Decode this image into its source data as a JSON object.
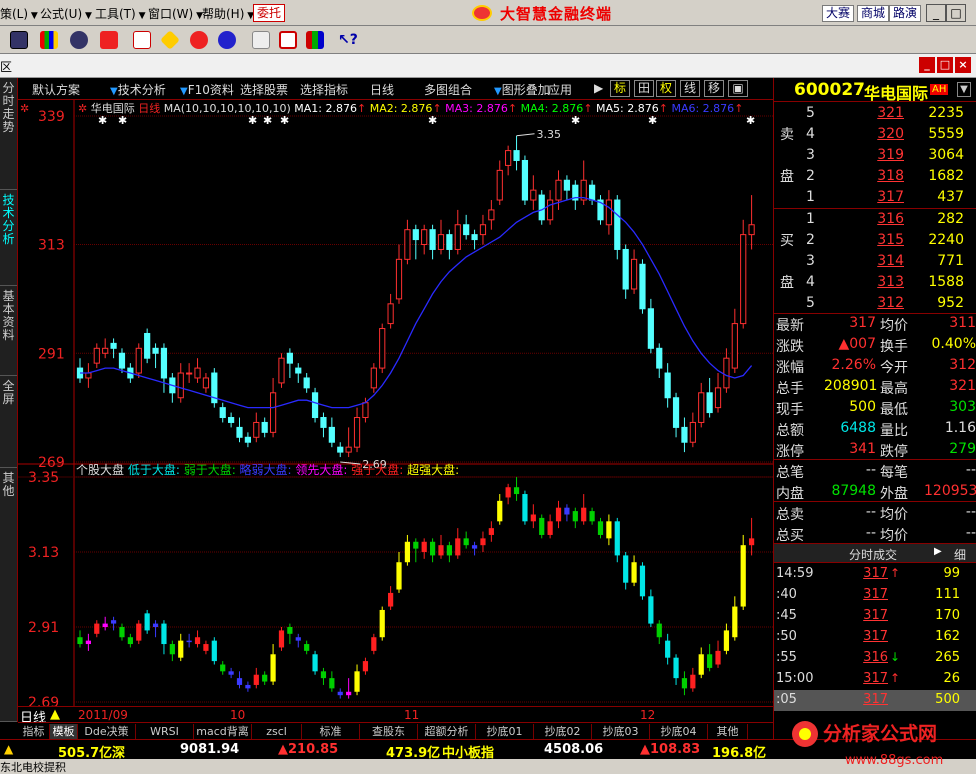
{
  "menu": {
    "items": [
      {
        "label": "策(L)",
        "x": 0
      },
      {
        "label": "公式(U)",
        "x": 40
      },
      {
        "label": "工具(T)",
        "x": 95
      },
      {
        "label": "窗口(W)",
        "x": 148
      },
      {
        "label": "帮助(H)",
        "x": 202
      }
    ],
    "entrust": "委托",
    "app_title": "大智慧金融终端",
    "buttons": [
      "大赛",
      "商城",
      "路演"
    ],
    "window_buttons": [
      "_",
      "□",
      "×"
    ]
  },
  "subbar": {
    "label": "区",
    "buttons": [
      "_",
      "□",
      "×"
    ]
  },
  "left_tabs": [
    "分时走势",
    "技术分析",
    "基本资料",
    "全屏",
    "其他"
  ],
  "chart_tools": {
    "items": [
      "默认方案",
      "技术分析",
      "F10资料",
      "选择股票",
      "选择指标",
      "日线",
      "多图组合",
      "图形叠加",
      "应用"
    ],
    "boxes": [
      "标",
      "田",
      "权",
      "线",
      "移",
      "▣",
      "□",
      "◫"
    ]
  },
  "price_chart": {
    "name": "华电国际",
    "period": "日线",
    "ma_params": "MA(10,10,10,10,10,10)",
    "ma": [
      {
        "label": "MA1:",
        "value": "2.876",
        "color": "#ffffff"
      },
      {
        "label": "MA2:",
        "value": "2.876",
        "color": "#ffff00"
      },
      {
        "label": "MA3:",
        "value": "2.876",
        "color": "#ff00ff"
      },
      {
        "label": "MA4:",
        "value": "2.876",
        "color": "#00ff00"
      },
      {
        "label": "MA5:",
        "value": "2.876",
        "color": "#ffffff"
      },
      {
        "label": "MA6:",
        "value": "2.876",
        "color": "#3a3aff"
      }
    ],
    "axis_labels": [
      "339",
      "313",
      "291",
      "269"
    ],
    "high_note": "3.35",
    "low_note": "2.69"
  },
  "indicator_chart": {
    "name": "个股大盘",
    "legend": [
      {
        "label": "低于大盘:",
        "color": "#00e6e6"
      },
      {
        "label": "弱于大盘:",
        "color": "#00d000"
      },
      {
        "label": "略弱大盘:",
        "color": "#3a3aff"
      },
      {
        "label": "领先大盘:",
        "color": "#ff00ff"
      },
      {
        "label": "强于大盘:",
        "color": "#ff2020"
      },
      {
        "label": "超强大盘:",
        "color": "#ffff00"
      }
    ],
    "axis_labels": [
      "3.35",
      "3.13",
      "2.91",
      "2.69"
    ]
  },
  "chart_data": {
    "type": "candlestick",
    "categories": [
      "2011/09",
      "10",
      "11",
      "12"
    ],
    "ylim": [
      2.69,
      3.39
    ],
    "candles": [
      [
        2.88,
        2.86,
        2.9,
        2.85
      ],
      [
        2.86,
        2.87,
        2.89,
        2.84
      ],
      [
        2.89,
        2.92,
        2.93,
        2.88
      ],
      [
        2.91,
        2.92,
        2.94,
        2.9
      ],
      [
        2.93,
        2.92,
        2.94,
        2.9
      ],
      [
        2.91,
        2.88,
        2.92,
        2.87
      ],
      [
        2.88,
        2.86,
        2.89,
        2.85
      ],
      [
        2.87,
        2.92,
        2.93,
        2.86
      ],
      [
        2.95,
        2.9,
        2.96,
        2.89
      ],
      [
        2.92,
        2.91,
        2.93,
        2.88
      ],
      [
        2.92,
        2.86,
        2.93,
        2.83
      ],
      [
        2.86,
        2.83,
        2.87,
        2.81
      ],
      [
        2.82,
        2.87,
        2.89,
        2.81
      ],
      [
        2.87,
        2.87,
        2.89,
        2.85
      ],
      [
        2.86,
        2.88,
        2.9,
        2.85
      ],
      [
        2.84,
        2.86,
        2.87,
        2.83
      ],
      [
        2.87,
        2.81,
        2.88,
        2.8
      ],
      [
        2.8,
        2.78,
        2.81,
        2.77
      ],
      [
        2.78,
        2.77,
        2.79,
        2.76
      ],
      [
        2.76,
        2.74,
        2.78,
        2.73
      ],
      [
        2.74,
        2.73,
        2.75,
        2.72
      ],
      [
        2.74,
        2.77,
        2.79,
        2.73
      ],
      [
        2.77,
        2.75,
        2.78,
        2.74
      ],
      [
        2.75,
        2.83,
        2.86,
        2.74
      ],
      [
        2.85,
        2.9,
        2.91,
        2.84
      ],
      [
        2.91,
        2.89,
        2.92,
        2.86
      ],
      [
        2.88,
        2.87,
        2.89,
        2.85
      ],
      [
        2.86,
        2.84,
        2.87,
        2.83
      ],
      [
        2.83,
        2.78,
        2.84,
        2.77
      ],
      [
        2.78,
        2.76,
        2.79,
        2.74
      ],
      [
        2.76,
        2.73,
        2.78,
        2.72
      ],
      [
        2.72,
        2.71,
        2.73,
        2.7
      ],
      [
        2.71,
        2.72,
        2.76,
        2.7
      ],
      [
        2.72,
        2.78,
        2.8,
        2.71
      ],
      [
        2.78,
        2.81,
        2.82,
        2.77
      ],
      [
        2.84,
        2.88,
        2.89,
        2.83
      ],
      [
        2.88,
        2.96,
        2.97,
        2.87
      ],
      [
        2.97,
        3.01,
        3.03,
        2.96
      ],
      [
        3.02,
        3.1,
        3.13,
        3.01
      ],
      [
        3.1,
        3.16,
        3.18,
        3.09
      ],
      [
        3.16,
        3.14,
        3.17,
        3.1
      ],
      [
        3.13,
        3.16,
        3.17,
        3.11
      ],
      [
        3.16,
        3.12,
        3.17,
        3.1
      ],
      [
        3.12,
        3.15,
        3.18,
        3.11
      ],
      [
        3.15,
        3.12,
        3.16,
        3.1
      ],
      [
        3.12,
        3.17,
        3.2,
        3.11
      ],
      [
        3.17,
        3.15,
        3.19,
        3.14
      ],
      [
        3.15,
        3.14,
        3.16,
        3.12
      ],
      [
        3.15,
        3.17,
        3.19,
        3.13
      ],
      [
        3.18,
        3.2,
        3.22,
        3.16
      ],
      [
        3.22,
        3.28,
        3.3,
        3.21
      ],
      [
        3.29,
        3.32,
        3.33,
        3.27
      ],
      [
        3.32,
        3.3,
        3.35,
        3.28
      ],
      [
        3.3,
        3.22,
        3.31,
        3.21
      ],
      [
        3.22,
        3.24,
        3.27,
        3.2
      ],
      [
        3.23,
        3.18,
        3.24,
        3.17
      ],
      [
        3.18,
        3.22,
        3.24,
        3.17
      ],
      [
        3.22,
        3.26,
        3.28,
        3.2
      ],
      [
        3.26,
        3.24,
        3.27,
        3.22
      ],
      [
        3.25,
        3.22,
        3.26,
        3.2
      ],
      [
        3.22,
        3.26,
        3.3,
        3.21
      ],
      [
        3.25,
        3.22,
        3.26,
        3.21
      ],
      [
        3.22,
        3.18,
        3.23,
        3.17
      ],
      [
        3.17,
        3.22,
        3.24,
        3.15
      ],
      [
        3.22,
        3.12,
        3.23,
        3.1
      ],
      [
        3.12,
        3.04,
        3.13,
        3.02
      ],
      [
        3.04,
        3.1,
        3.12,
        3.03
      ],
      [
        3.09,
        3.0,
        3.1,
        2.99
      ],
      [
        3.0,
        2.92,
        3.02,
        2.91
      ],
      [
        2.92,
        2.88,
        2.93,
        2.86
      ],
      [
        2.87,
        2.82,
        2.89,
        2.8
      ],
      [
        2.82,
        2.76,
        2.83,
        2.74
      ],
      [
        2.76,
        2.73,
        2.78,
        2.71
      ],
      [
        2.73,
        2.77,
        2.79,
        2.72
      ],
      [
        2.77,
        2.83,
        2.85,
        2.76
      ],
      [
        2.83,
        2.79,
        2.86,
        2.78
      ],
      [
        2.8,
        2.84,
        2.87,
        2.79
      ],
      [
        2.84,
        2.9,
        2.92,
        2.83
      ],
      [
        2.88,
        2.97,
        3.0,
        2.87
      ],
      [
        2.97,
        3.15,
        3.18,
        2.96
      ],
      [
        3.15,
        3.17,
        3.23,
        3.12
      ]
    ],
    "ma_line": [
      2.87,
      2.87,
      2.875,
      2.88,
      2.88,
      2.875,
      2.87,
      2.865,
      2.86,
      2.855,
      2.85,
      2.845,
      2.84,
      2.835,
      2.83,
      2.825,
      2.82,
      2.815,
      2.81,
      2.805,
      2.8,
      2.8,
      2.8,
      2.8,
      2.805,
      2.81,
      2.815,
      2.815,
      2.81,
      2.805,
      2.8,
      2.8,
      2.8,
      2.805,
      2.81,
      2.825,
      2.845,
      2.87,
      2.9,
      2.935,
      2.97,
      3.0,
      3.03,
      3.055,
      3.075,
      3.09,
      3.105,
      3.115,
      3.125,
      3.135,
      3.145,
      3.16,
      3.175,
      3.185,
      3.195,
      3.2,
      3.21,
      3.215,
      3.22,
      3.225,
      3.225,
      3.22,
      3.215,
      3.205,
      3.19,
      3.175,
      3.155,
      3.13,
      3.1,
      3.07,
      3.035,
      3.0,
      2.965,
      2.935,
      2.91,
      2.89,
      2.875,
      2.865,
      2.86,
      2.865,
      2.885
    ]
  },
  "stock": {
    "code": "600027",
    "name": "华电国际",
    "badge": "AH"
  },
  "orderbook": {
    "sell_label": [
      "卖",
      "盘"
    ],
    "buy_label": [
      "买",
      "盘"
    ],
    "sell": [
      {
        "level": "5",
        "price": "321",
        "vol": "2235"
      },
      {
        "level": "4",
        "price": "320",
        "vol": "5559"
      },
      {
        "level": "3",
        "price": "319",
        "vol": "3064"
      },
      {
        "level": "2",
        "price": "318",
        "vol": "1682"
      },
      {
        "level": "1",
        "price": "317",
        "vol": "437"
      }
    ],
    "buy": [
      {
        "level": "1",
        "price": "316",
        "vol": "282"
      },
      {
        "level": "2",
        "price": "315",
        "vol": "2240"
      },
      {
        "level": "3",
        "price": "314",
        "vol": "771"
      },
      {
        "level": "4",
        "price": "313",
        "vol": "1588"
      },
      {
        "level": "5",
        "price": "312",
        "vol": "952"
      }
    ]
  },
  "quote": [
    {
      "k1": "最新",
      "v1": "317",
      "c1": "#ff3030",
      "k2": "均价",
      "v2": "311",
      "c2": "#ff3030"
    },
    {
      "k1": "涨跌",
      "v1": "▲007",
      "c1": "#ff3030",
      "k2": "换手",
      "v2": "0.40%",
      "c2": "#ffff00"
    },
    {
      "k1": "涨幅",
      "v1": "2.26%",
      "c1": "#ff3030",
      "k2": "今开",
      "v2": "312",
      "c2": "#ff3030"
    },
    {
      "k1": "总手",
      "v1": "208901",
      "c1": "#ffff00",
      "k2": "最高",
      "v2": "321",
      "c2": "#ff3030"
    },
    {
      "k1": "现手",
      "v1": "500",
      "c1": "#ffff00",
      "k2": "最低",
      "v2": "303",
      "c2": "#00e000"
    },
    {
      "k1": "总额",
      "v1": "6488",
      "c1": "#00e6e6",
      "k2": "量比",
      "v2": "1.16",
      "c2": "#dddddd"
    },
    {
      "k1": "涨停",
      "v1": "341",
      "c1": "#ff3030",
      "k2": "跌停",
      "v2": "279",
      "c2": "#00e000"
    },
    {
      "k1": "总笔",
      "v1": "--",
      "c1": "#dddddd",
      "k2": "每笔",
      "v2": "--",
      "c2": "#dddddd"
    },
    {
      "k1": "内盘",
      "v1": "87948",
      "c1": "#00e000",
      "k2": "外盘",
      "v2": "120953",
      "c2": "#ff3030"
    },
    {
      "k1": "总卖",
      "v1": "--",
      "c1": "#dddddd",
      "k2": "均价",
      "v2": "--",
      "c2": "#dddddd"
    },
    {
      "k1": "总买",
      "v1": "--",
      "c1": "#dddddd",
      "k2": "均价",
      "v2": "--",
      "c2": "#dddddd"
    }
  ],
  "ticks": {
    "header": "分时成交",
    "detail": "细",
    "rows": [
      {
        "t": "14:59",
        "p": "317",
        "arrow": "↑",
        "ac": "#ff3030",
        "v": "99"
      },
      {
        "t": ":40",
        "p": "317",
        "arrow": "",
        "ac": "#ff3030",
        "v": "111"
      },
      {
        "t": ":45",
        "p": "317",
        "arrow": "",
        "ac": "#ff3030",
        "v": "170"
      },
      {
        "t": ":50",
        "p": "317",
        "arrow": "",
        "ac": "#ff3030",
        "v": "162"
      },
      {
        "t": ":55",
        "p": "316",
        "arrow": "↓",
        "ac": "#00e000",
        "v": "265"
      },
      {
        "t": "15:00",
        "p": "317",
        "arrow": "↑",
        "ac": "#ff3030",
        "v": "26"
      },
      {
        "t": ":05",
        "p": "317",
        "arrow": "",
        "ac": "#ff3030",
        "v": "500"
      }
    ]
  },
  "xaxis": {
    "period": "日线",
    "labels": [
      "2011/09",
      "10",
      "11",
      "12"
    ]
  },
  "bottom_tabs": [
    "指标",
    "模板",
    "Dde决策",
    "WRSI",
    "macd背离",
    "zscl",
    "标准",
    "查股东",
    "超额分析",
    "抄底01",
    "抄底02",
    "抄底03",
    "抄底04",
    "其他"
  ],
  "statusbar": [
    {
      "text": "505.7亿",
      "color": "#ffff00"
    },
    {
      "text": "深",
      "color": "#ffff00"
    },
    {
      "text": "9081.94",
      "color": "#ffffff"
    },
    {
      "text": "▲210.85",
      "color": "#ff3030"
    },
    {
      "text": "473.9亿",
      "color": "#ffff00"
    },
    {
      "text": "中小板指",
      "color": "#ffff00"
    },
    {
      "text": "4508.06",
      "color": "#ffffff"
    },
    {
      "text": "▲108.83",
      "color": "#ff3030"
    },
    {
      "text": "196.8亿",
      "color": "#ffff00"
    }
  ],
  "ticker": "东北电校提积",
  "watermark": {
    "text": "分析家公式网",
    "url": "www.88gs.com"
  }
}
